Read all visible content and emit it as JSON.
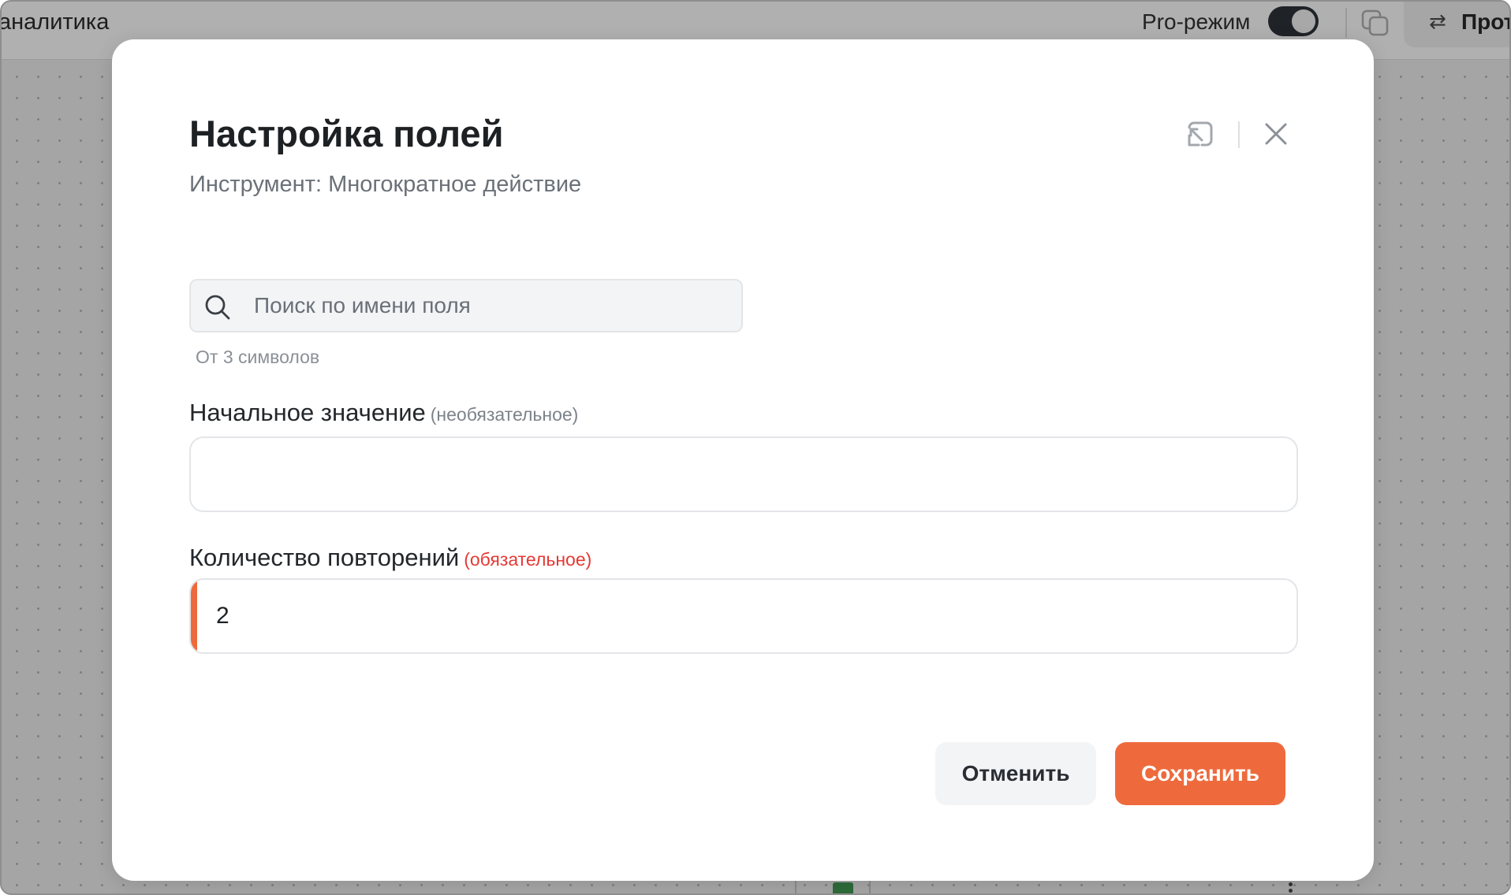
{
  "topbar": {
    "left_text": "аналитика",
    "pro_mode_label": "Pro-режим",
    "pro_mode_on": true,
    "proto_arrows": "⇄",
    "proto_label": "Прот"
  },
  "modal": {
    "title": "Настройка полей",
    "subtitle": "Инструмент: Многократное действие",
    "search": {
      "placeholder": "Поиск по имени поля",
      "value": "",
      "hint": "От 3 символов"
    },
    "fields": [
      {
        "label": "Начальное значение",
        "qualifier": "(необязательное)",
        "value": ""
      },
      {
        "label": "Количество повторений",
        "qualifier": "(обязательное)",
        "value": "2"
      }
    ],
    "buttons": {
      "cancel": "Отменить",
      "save": "Сохранить"
    }
  },
  "colors": {
    "accent": "#ee6a3c",
    "required": "#e53935",
    "title": "#1e2124",
    "muted": "#6b7178"
  },
  "icons": {
    "minimize": "minimize-icon",
    "close": "close-icon",
    "search": "search-icon",
    "copy": "copy-icon"
  }
}
